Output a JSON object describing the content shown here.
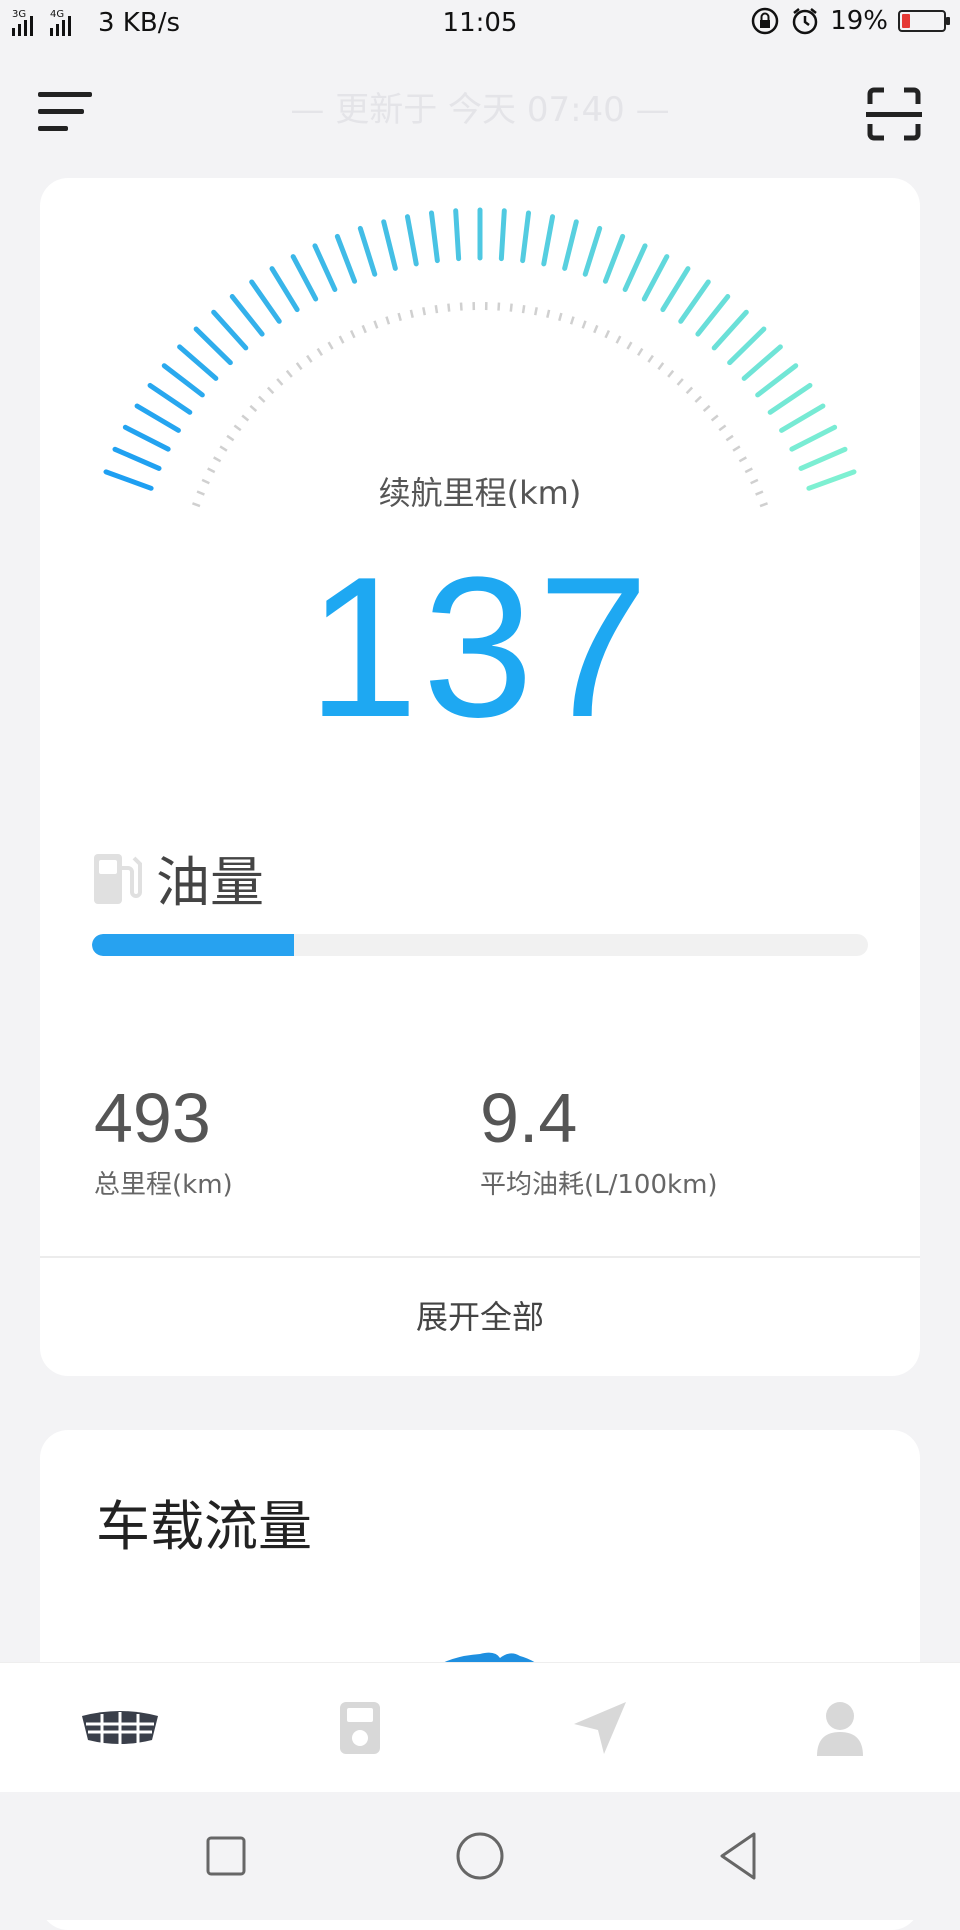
{
  "status_bar": {
    "network_label_1": "3G",
    "network_label_2": "4G",
    "speed": "3 KB/s",
    "time": "11:05",
    "battery": "19%",
    "battery_level": 0.19
  },
  "header": {
    "update_text": "— 更新于 今天 07:40 —",
    "menu_icon": "menu-icon",
    "scan_icon": "scan-icon"
  },
  "range": {
    "label": "续航里程(km)",
    "value": "137"
  },
  "fuel": {
    "label": "油量",
    "level": 0.26,
    "fill_color": "#27a2f0"
  },
  "stats": [
    {
      "value": "493",
      "label": "总里程(km)"
    },
    {
      "value": "9.4",
      "label": "平均油耗(L/100km)"
    }
  ],
  "expand_label": "展开全部",
  "traffic_card": {
    "title": "车载流量"
  },
  "tabs": [
    {
      "icon": "car-brand-icon",
      "active": true
    },
    {
      "icon": "fuel-station-icon",
      "active": false
    },
    {
      "icon": "navigation-icon",
      "active": false
    },
    {
      "icon": "profile-icon",
      "active": false
    }
  ],
  "colors": {
    "accent": "#1ea8f2",
    "gauge_start": "#1e9ff2",
    "gauge_end": "#7ef0d2"
  }
}
